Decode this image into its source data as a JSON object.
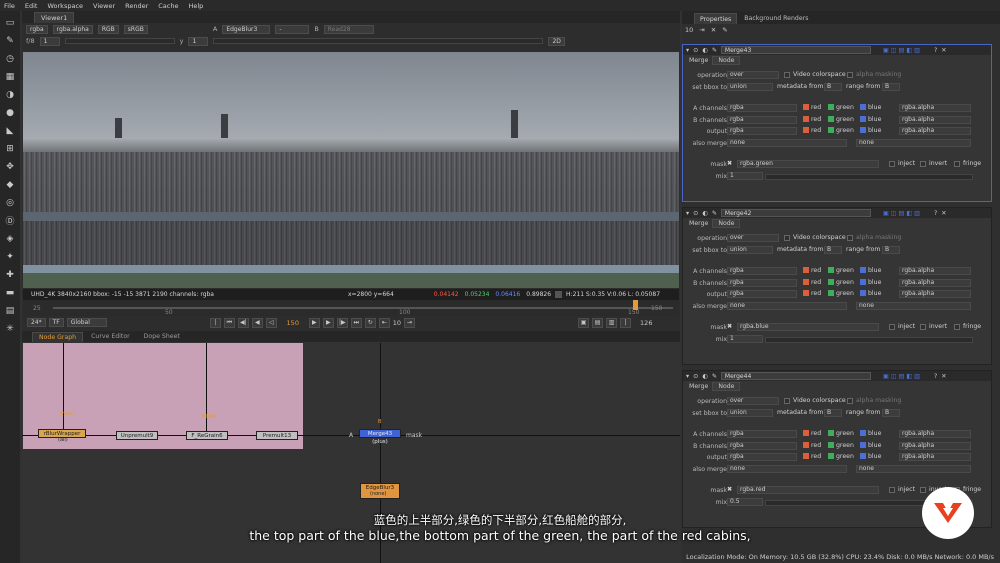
{
  "menu": [
    "File",
    "Edit",
    "Workspace",
    "Viewer",
    "Render",
    "Cache",
    "Help"
  ],
  "viewer": {
    "tab": "Viewer1",
    "channels": "rgba",
    "alpha": "rgba.alpha",
    "colorspace_a": "RGB",
    "colorspace_b": "sRGB",
    "input_a": "EdgeBlur3",
    "input_b": "Read28",
    "a_label": "A",
    "b_label": "B",
    "dash": "-",
    "fstop": "f/8",
    "gain": "1",
    "ylabel": "y",
    "yval": "1",
    "mode": "2D",
    "info_left": "UHD_4K 3840x2160  bbox: -15 -15 3871 2190 channels: rgba",
    "coords": "x=2800 y=664",
    "r": "0.04142",
    "g": "0.05234",
    "b": "0.06416",
    "a": "0.89826",
    "hsvl": "H:211 S:0.35 V:0.06  L: 0.05087",
    "tl_ticks": [
      "25",
      "50",
      "100",
      "150"
    ],
    "tl_end": "150",
    "fps": "24*",
    "tf": "TF",
    "scope": "Global",
    "frame": "150",
    "step": "10",
    "last": "126"
  },
  "nodegraph": {
    "tabs": [
      "Node Graph",
      "Curve Editor",
      "Dope Sheet"
    ],
    "nodes": [
      {
        "label": "rBlurWrapper",
        "sub": "(all)"
      },
      {
        "label": "Unpremult9"
      },
      {
        "label": "F_ReGrain6"
      },
      {
        "label": "Premult13"
      },
      {
        "label": "Merge43 (plus)"
      },
      {
        "label": "EdgeBlur3",
        "sub": "(none)"
      }
    ],
    "mask_label": "mask",
    "mask_small": "mask",
    "a_small": "A",
    "b_small": "B",
    "merge_mask": "mask",
    "grain_label": "RGBA"
  },
  "subtitles": {
    "cn": "蓝色的上半部分,绿色的下半部分,红色船舱的部分,",
    "en": "the top part of the blue,the bottom part of the green, the part of the red cabins,"
  },
  "status": "Localization Mode: On Memory: 10.5 GB (32.8%) CPU: 23.4% Disk: 0.0 MB/s Network: 0.0 MB/s",
  "props": {
    "tabs": [
      "Properties",
      "Background Renders"
    ],
    "count": "10",
    "panels": [
      {
        "name": "Merge43",
        "mask_channel": "rgba.green",
        "mix": "1"
      },
      {
        "name": "Merge42",
        "mask_channel": "rgba.blue",
        "mix": "1"
      },
      {
        "name": "Merge44",
        "mask_channel": "rgba.red",
        "mix": "0.5"
      }
    ],
    "sub_tabs": [
      "Merge",
      "Node"
    ],
    "labels": {
      "operation": "operation",
      "setbbox": "set bbox to",
      "achan": "A channels",
      "bchan": "B channels",
      "output": "output",
      "also": "also merge",
      "mask": "mask",
      "mix": "mix",
      "video": "Video colorspace",
      "alpham": "alpha masking",
      "metadata": "metadata from",
      "range": "range from",
      "inject": "inject",
      "invert": "invert",
      "fringe": "fringe"
    },
    "values": {
      "operation": "over",
      "setbbox": "union",
      "b": "B",
      "rgba": "rgba",
      "ralpha": "rgba.alpha",
      "none": "none",
      "red": "red",
      "green": "green",
      "blue": "blue"
    },
    "colors": {
      "red": "#d9603a",
      "green": "#3fae5a",
      "blue": "#4a6fd8"
    }
  }
}
